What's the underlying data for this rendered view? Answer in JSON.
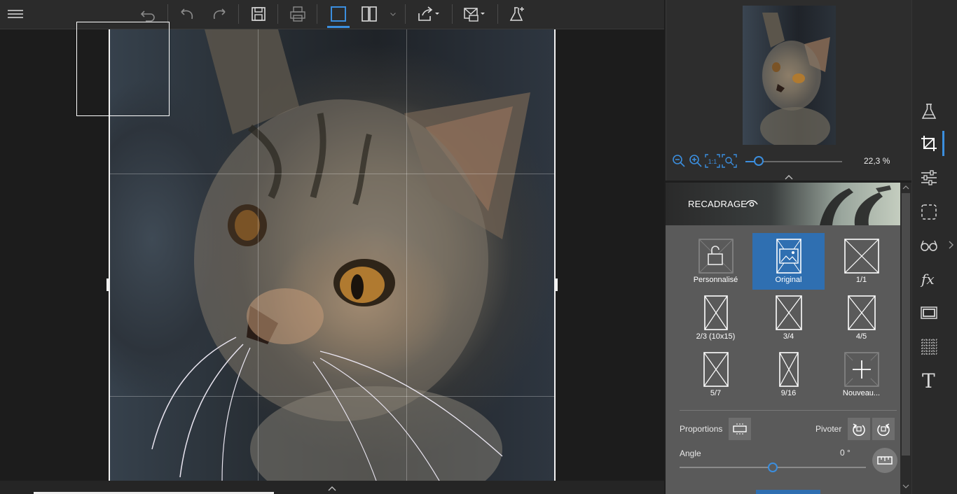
{
  "toolbar": {
    "items": [
      {
        "name": "menu",
        "icon": "hamburger-icon"
      },
      {
        "name": "revert",
        "icon": "revert-icon"
      },
      {
        "name": "undo",
        "icon": "undo-icon"
      },
      {
        "name": "redo",
        "icon": "redo-icon"
      },
      {
        "name": "save",
        "icon": "save-icon"
      },
      {
        "name": "print",
        "icon": "print-icon"
      },
      {
        "name": "single-view",
        "icon": "single-view-icon",
        "active": true
      },
      {
        "name": "compare-view",
        "icon": "compare-view-icon"
      },
      {
        "name": "share",
        "icon": "share-icon"
      },
      {
        "name": "send",
        "icon": "send-icon"
      },
      {
        "name": "effects",
        "icon": "flask-plus-icon"
      }
    ]
  },
  "navigator": {
    "zoom_value": "22,3 %",
    "zoom_fraction": 0.14,
    "tools": [
      "zoom-out-icon",
      "zoom-in-icon",
      "actual-size-icon",
      "fit-icon"
    ]
  },
  "crop": {
    "title": "RECADRAGE",
    "ratios": [
      {
        "label": "Personnalisé",
        "icon": "lock-open-icon"
      },
      {
        "label": "Original",
        "icon": "image-icon",
        "selected": true
      },
      {
        "label": "1/1",
        "icon": "ratio-icon"
      },
      {
        "label": "2/3 (10x15)",
        "icon": "ratio-icon"
      },
      {
        "label": "3/4",
        "icon": "ratio-icon"
      },
      {
        "label": "4/5",
        "icon": "ratio-icon"
      },
      {
        "label": "5/7",
        "icon": "ratio-icon"
      },
      {
        "label": "9/16",
        "icon": "ratio-icon"
      },
      {
        "label": "Nouveau...",
        "icon": "add-ratio-icon"
      }
    ],
    "proportions_label": "Proportions",
    "rotate_label": "Pivoter",
    "angle_label": "Angle",
    "angle_value": "0 °",
    "angle_fraction": 0.5
  },
  "rail": {
    "items": [
      "flask-icon",
      "crop-icon",
      "adjust-sliders-icon",
      "selection-icon",
      "glasses-icon",
      "fx-icon",
      "frame-icon",
      "texture-icon",
      "text-icon"
    ],
    "active": "crop-icon"
  }
}
